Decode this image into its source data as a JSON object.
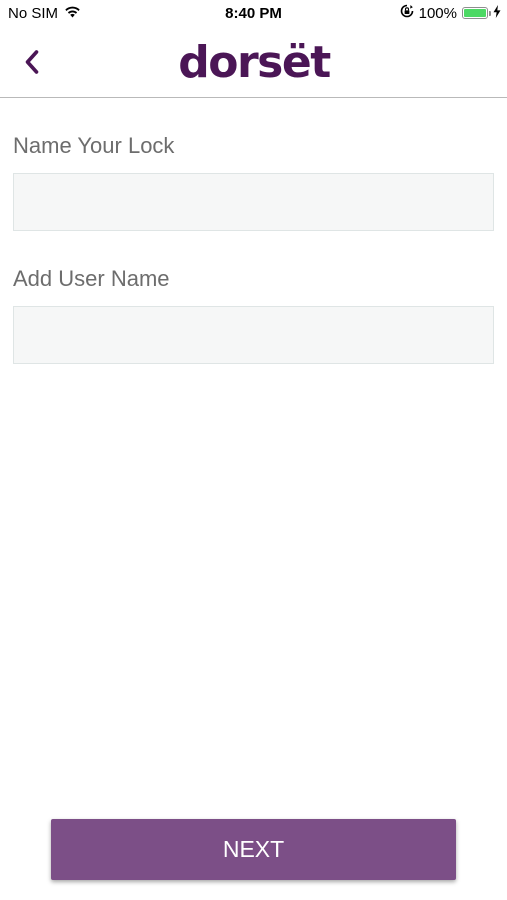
{
  "status_bar": {
    "carrier": "No SIM",
    "time": "8:40 PM",
    "battery_percent": "100%",
    "battery_level": 1.0,
    "battery_color": "#4cd964",
    "icons": [
      "wifi-icon",
      "orientation-lock-icon",
      "battery-icon",
      "charging-bolt-icon"
    ]
  },
  "nav": {
    "back_icon": "chevron-left-icon",
    "logo_text": "dorsët",
    "brand_color": "#4b1656",
    "accent_color": "#7c4f87"
  },
  "form": {
    "lock_name": {
      "label": "Name Your Lock",
      "value": "",
      "placeholder": ""
    },
    "user_name": {
      "label": "Add User Name",
      "value": "",
      "placeholder": ""
    }
  },
  "actions": {
    "next_label": "NEXT"
  }
}
